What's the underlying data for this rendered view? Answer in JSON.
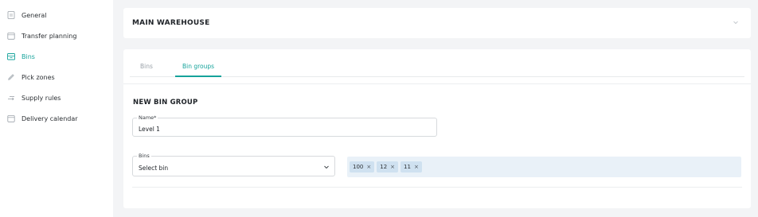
{
  "sidebar": {
    "items": [
      {
        "label": "General",
        "icon": "document-icon"
      },
      {
        "label": "Transfer planning",
        "icon": "calendar-icon"
      },
      {
        "label": "Bins",
        "icon": "box-icon",
        "active": true
      },
      {
        "label": "Pick zones",
        "icon": "pencil-icon"
      },
      {
        "label": "Supply rules",
        "icon": "arrows-icon"
      },
      {
        "label": "Delivery calendar",
        "icon": "calendar-icon"
      }
    ]
  },
  "warehouse": {
    "title": "MAIN WAREHOUSE"
  },
  "tabs": [
    {
      "label": "Bins"
    },
    {
      "label": "Bin groups",
      "active": true
    }
  ],
  "form": {
    "section_title": "NEW BIN GROUP",
    "name_label": "Name*",
    "name_value": "Level 1",
    "bins_label": "Bins",
    "bins_placeholder": "Select bin",
    "selected_bins": [
      "100",
      "12",
      "11"
    ]
  },
  "colors": {
    "accent": "#16a39b",
    "chip_bg": "#cfe1f0",
    "chips_area_bg": "#e9f1f8"
  }
}
